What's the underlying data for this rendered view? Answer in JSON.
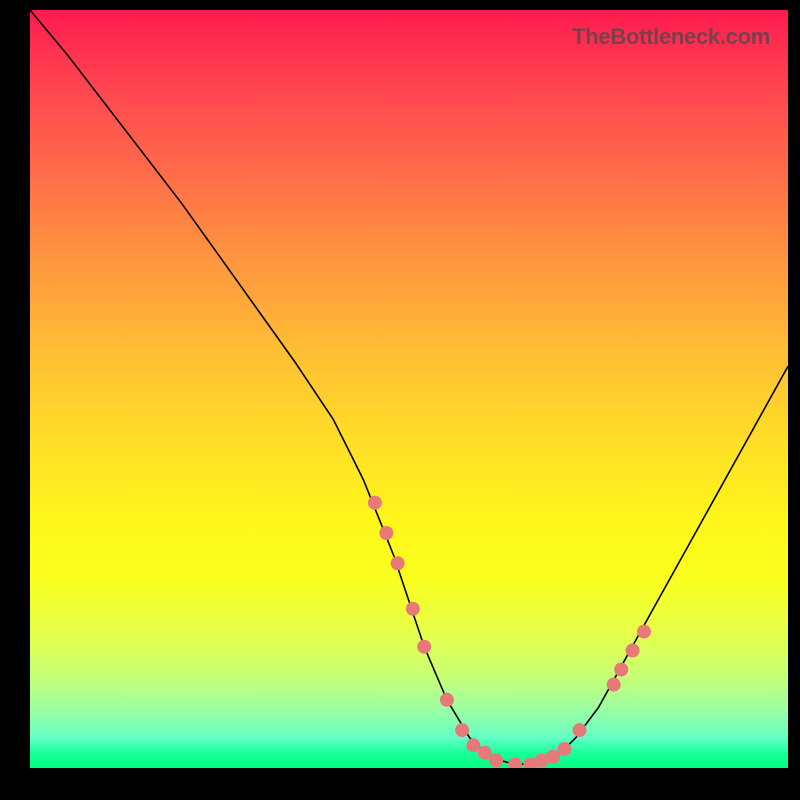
{
  "watermark": "TheBottleneck.com",
  "chart_data": {
    "type": "line",
    "title": "",
    "xlabel": "",
    "ylabel": "",
    "xlim": [
      0,
      100
    ],
    "ylim": [
      0,
      100
    ],
    "series": [
      {
        "name": "curve",
        "x": [
          0,
          5,
          10,
          15,
          20,
          25,
          30,
          35,
          40,
          42,
          44,
          46,
          48,
          50,
          52,
          55,
          58,
          60,
          62,
          64,
          66,
          68,
          70,
          72,
          75,
          80,
          85,
          90,
          95,
          100
        ],
        "values": [
          100,
          94,
          87.5,
          81,
          74.5,
          67.5,
          60.5,
          53.5,
          46,
          42,
          38,
          33,
          28,
          22,
          16,
          9,
          4,
          2,
          1,
          0.5,
          0.5,
          1,
          2,
          4,
          8,
          17,
          26,
          35,
          44,
          53
        ]
      }
    ],
    "markers": {
      "name": "highlighted-points",
      "color": "#e77a78",
      "x": [
        45.5,
        47,
        48.5,
        50.5,
        52,
        55,
        57,
        58.5,
        60,
        61.5,
        64,
        66,
        67.5,
        69,
        70.5,
        72.5,
        77,
        78,
        79.5,
        81
      ],
      "values": [
        35,
        31,
        27,
        21,
        16,
        9,
        5,
        3,
        2,
        1,
        0.5,
        0.5,
        1,
        1.5,
        2.5,
        5,
        11,
        13,
        15.5,
        18
      ]
    }
  }
}
